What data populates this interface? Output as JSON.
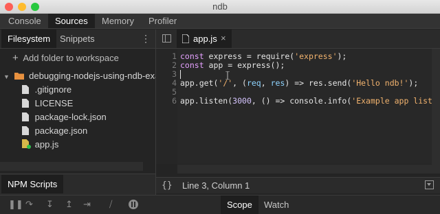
{
  "window": {
    "title": "ndb"
  },
  "main_tabs": [
    {
      "label": "Console"
    },
    {
      "label": "Sources"
    },
    {
      "label": "Memory"
    },
    {
      "label": "Profiler"
    }
  ],
  "navigator": {
    "tabs": [
      {
        "label": "Filesystem"
      },
      {
        "label": "Snippets"
      }
    ],
    "add_folder_label": "Add folder to workspace",
    "folder": {
      "label": "debugging-nodejs-using-ndb-exam"
    },
    "files": [
      {
        "label": ".gitignore"
      },
      {
        "label": "LICENSE"
      },
      {
        "label": "package-lock.json"
      },
      {
        "label": "package.json"
      },
      {
        "label": "app.js"
      }
    ],
    "npm_scripts_label": "NPM Scripts"
  },
  "editor": {
    "tab_label": "app.js",
    "lines": [
      {
        "no": "1"
      },
      {
        "no": "2"
      },
      {
        "no": "3"
      },
      {
        "no": "4"
      },
      {
        "no": "5"
      },
      {
        "no": "6"
      }
    ],
    "code": {
      "l1_kw": "const",
      "l1_rest": " express = require(",
      "l1_str": "'express'",
      "l1_end": ");",
      "l2_kw": "const",
      "l2_rest": " app = express();",
      "l4_a": "app.get(",
      "l4_str": "'/'",
      "l4_b": ", (",
      "l4_p1": "req",
      "l4_c": ", ",
      "l4_p2": "res",
      "l4_d": ") => res.send(",
      "l4_str2": "'Hello ndb!'",
      "l4_e": ");",
      "l6_a": "app.listen(",
      "l6_num": "3000",
      "l6_b": ", () => console.info(",
      "l6_str": "'Example app listen"
    },
    "status_braces": "{}",
    "status_position": "Line 3, Column 1"
  },
  "sidebar_tabs": [
    {
      "label": "Scope"
    },
    {
      "label": "Watch"
    }
  ],
  "colors": {
    "folder": "#e8913f",
    "file": "#d8d8d8",
    "active_dot": "#2fbf4e",
    "close_red": "#fd5f57",
    "min_yellow": "#febc2e",
    "max_green": "#28c840"
  }
}
